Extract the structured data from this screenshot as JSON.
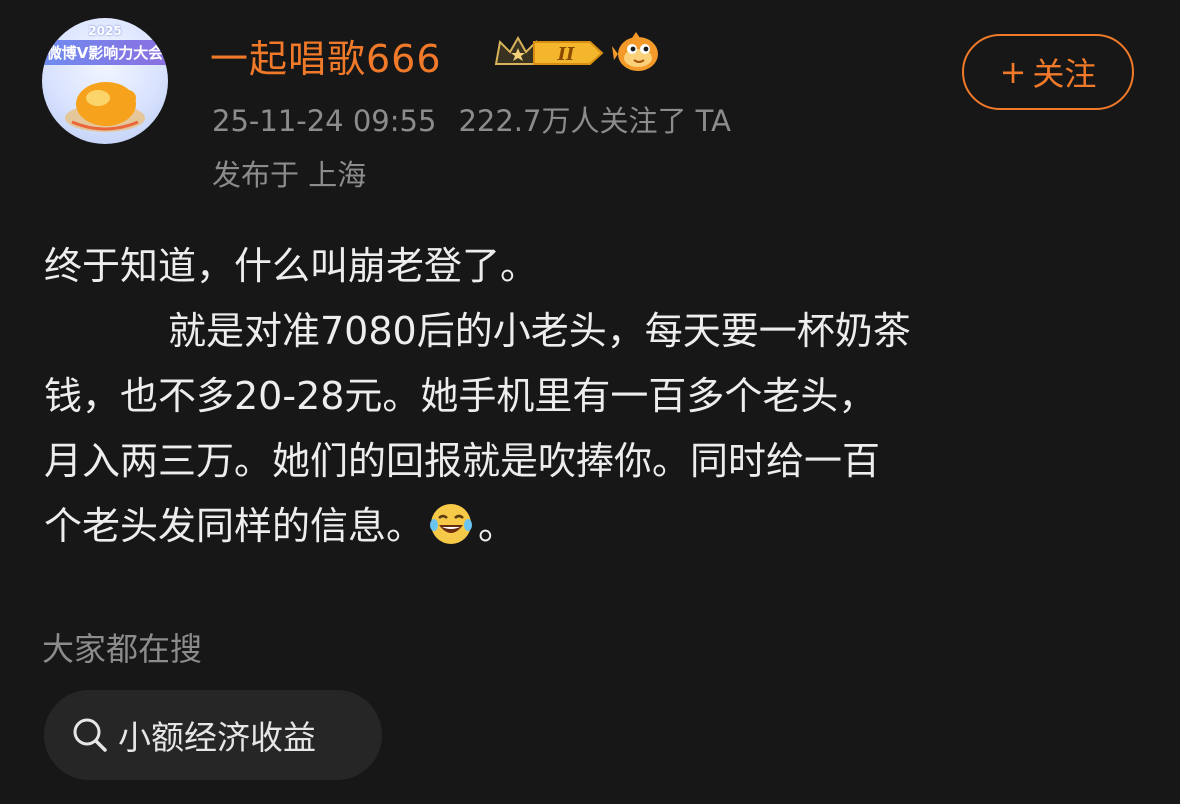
{
  "profile": {
    "username": "一起唱歌666",
    "avatar_year": "2025",
    "avatar_banner": "微博V影响力大会",
    "level_badge": "II",
    "timestamp": "25-11-24 09:55",
    "followers": "222.7万人关注了 TA",
    "location": "发布于 上海"
  },
  "follow_button": {
    "plus": "+",
    "label": "关注"
  },
  "post": {
    "line1": "终于知道，什么叫崩老登了。",
    "line2": "就是对准7080后的小老头，每天要一杯奶茶",
    "line3": "钱，也不多20-28元。她手机里有一百多个老头，",
    "line4": "月入两三万。她们的回报就是吹捧你。同时给一百",
    "line5_before_emoji": "个老头发同样的信息。",
    "line5_after_emoji": "。",
    "emoji_name": "laughing-tears-emoji"
  },
  "search": {
    "title": "大家都在搜",
    "chip_label": "小额经济收益"
  },
  "colors": {
    "background": "#171717",
    "accent": "#f07a2a",
    "muted_text": "#8c8c8c",
    "chip_background": "#262626"
  }
}
